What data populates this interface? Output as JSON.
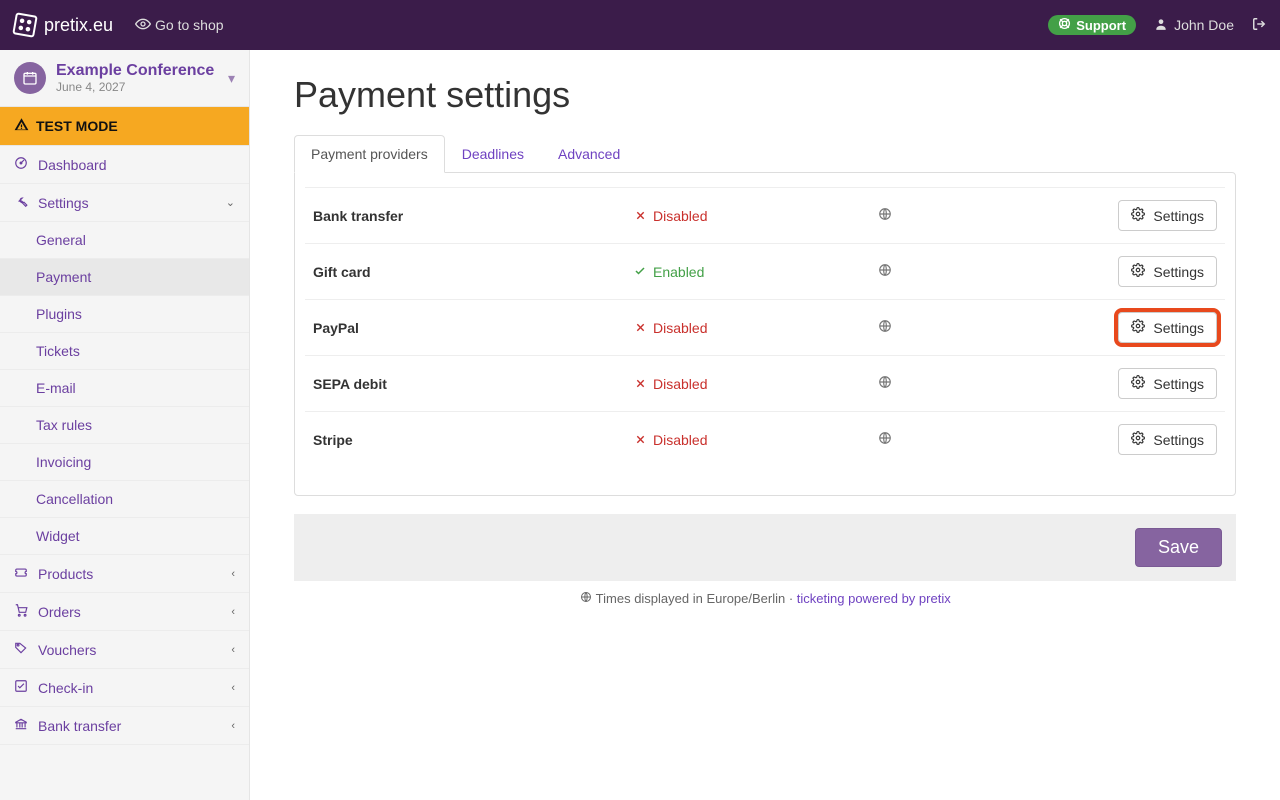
{
  "navbar": {
    "brand": "pretix.eu",
    "go_to_shop": "Go to shop",
    "support": "Support",
    "user": "John Doe"
  },
  "event": {
    "title": "Example Conference",
    "date": "June 4, 2027"
  },
  "testmode": "TEST MODE",
  "sidebar": {
    "dashboard": "Dashboard",
    "settings": "Settings",
    "settings_children": {
      "general": "General",
      "payment": "Payment",
      "plugins": "Plugins",
      "tickets": "Tickets",
      "email": "E-mail",
      "tax": "Tax rules",
      "invoicing": "Invoicing",
      "cancellation": "Cancellation",
      "widget": "Widget"
    },
    "products": "Products",
    "orders": "Orders",
    "vouchers": "Vouchers",
    "checkin": "Check-in",
    "banktransfer": "Bank transfer"
  },
  "page": {
    "title": "Payment settings",
    "tabs": {
      "providers": "Payment providers",
      "deadlines": "Deadlines",
      "advanced": "Advanced"
    },
    "settings_btn": "Settings",
    "status_enabled": "Enabled",
    "status_disabled": "Disabled",
    "providers": [
      {
        "name": "Bank transfer",
        "enabled": false
      },
      {
        "name": "Gift card",
        "enabled": true
      },
      {
        "name": "PayPal",
        "enabled": false,
        "highlight": true
      },
      {
        "name": "SEPA debit",
        "enabled": false
      },
      {
        "name": "Stripe",
        "enabled": false
      }
    ],
    "save": "Save"
  },
  "footer": {
    "tz": "Times displayed in Europe/Berlin",
    "sep": " · ",
    "powered": "ticketing powered by pretix"
  }
}
